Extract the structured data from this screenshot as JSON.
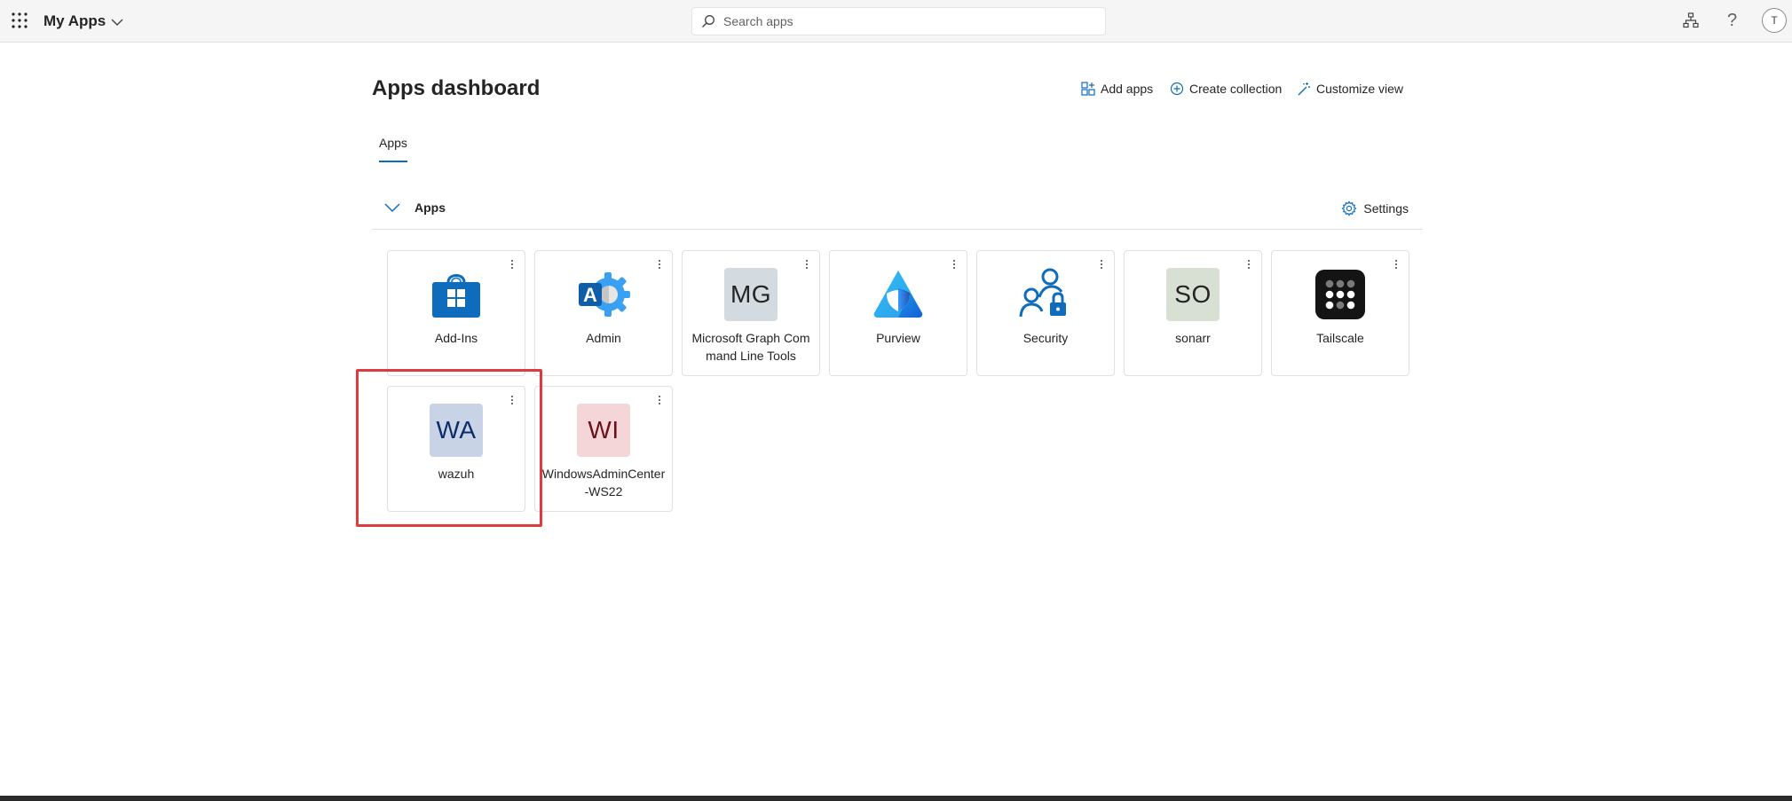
{
  "header": {
    "app_title": "My Apps",
    "search_placeholder": "Search apps",
    "avatar_initial": "T",
    "help_glyph": "?"
  },
  "dashboard": {
    "title": "Apps dashboard",
    "actions": {
      "add_apps": "Add apps",
      "create_collection": "Create collection",
      "customize_view": "Customize view"
    },
    "tabs": [
      {
        "label": "Apps",
        "selected": true
      }
    ]
  },
  "section": {
    "title": "Apps",
    "settings_label": "Settings"
  },
  "apps": [
    {
      "name": "Add-Ins",
      "icon": "store-bag-icon"
    },
    {
      "name": "Admin",
      "icon": "azure-admin-gear-icon"
    },
    {
      "name": "Microsoft Graph Command Line Tools",
      "icon": "monogram",
      "initials": "MG",
      "bg": "#d3dbe0",
      "fg": "#242424"
    },
    {
      "name": "Purview",
      "icon": "purview-icon"
    },
    {
      "name": "Security",
      "icon": "users-lock-icon"
    },
    {
      "name": "sonarr",
      "icon": "monogram",
      "initials": "SO",
      "bg": "#d8e0d3",
      "fg": "#242424"
    },
    {
      "name": "Tailscale",
      "icon": "tailscale-dots-icon"
    },
    {
      "name": "wazuh",
      "icon": "monogram",
      "initials": "WA",
      "bg": "#c9d3e6",
      "fg": "#0b2d6b",
      "highlighted": true
    },
    {
      "name": "WindowsAdminCenter-WS22",
      "icon": "monogram",
      "initials": "WI",
      "bg": "#f4d6d9",
      "fg": "#6b1119"
    }
  ],
  "colors": {
    "accent": "#0f6cbd",
    "highlight": "#e0393e"
  }
}
